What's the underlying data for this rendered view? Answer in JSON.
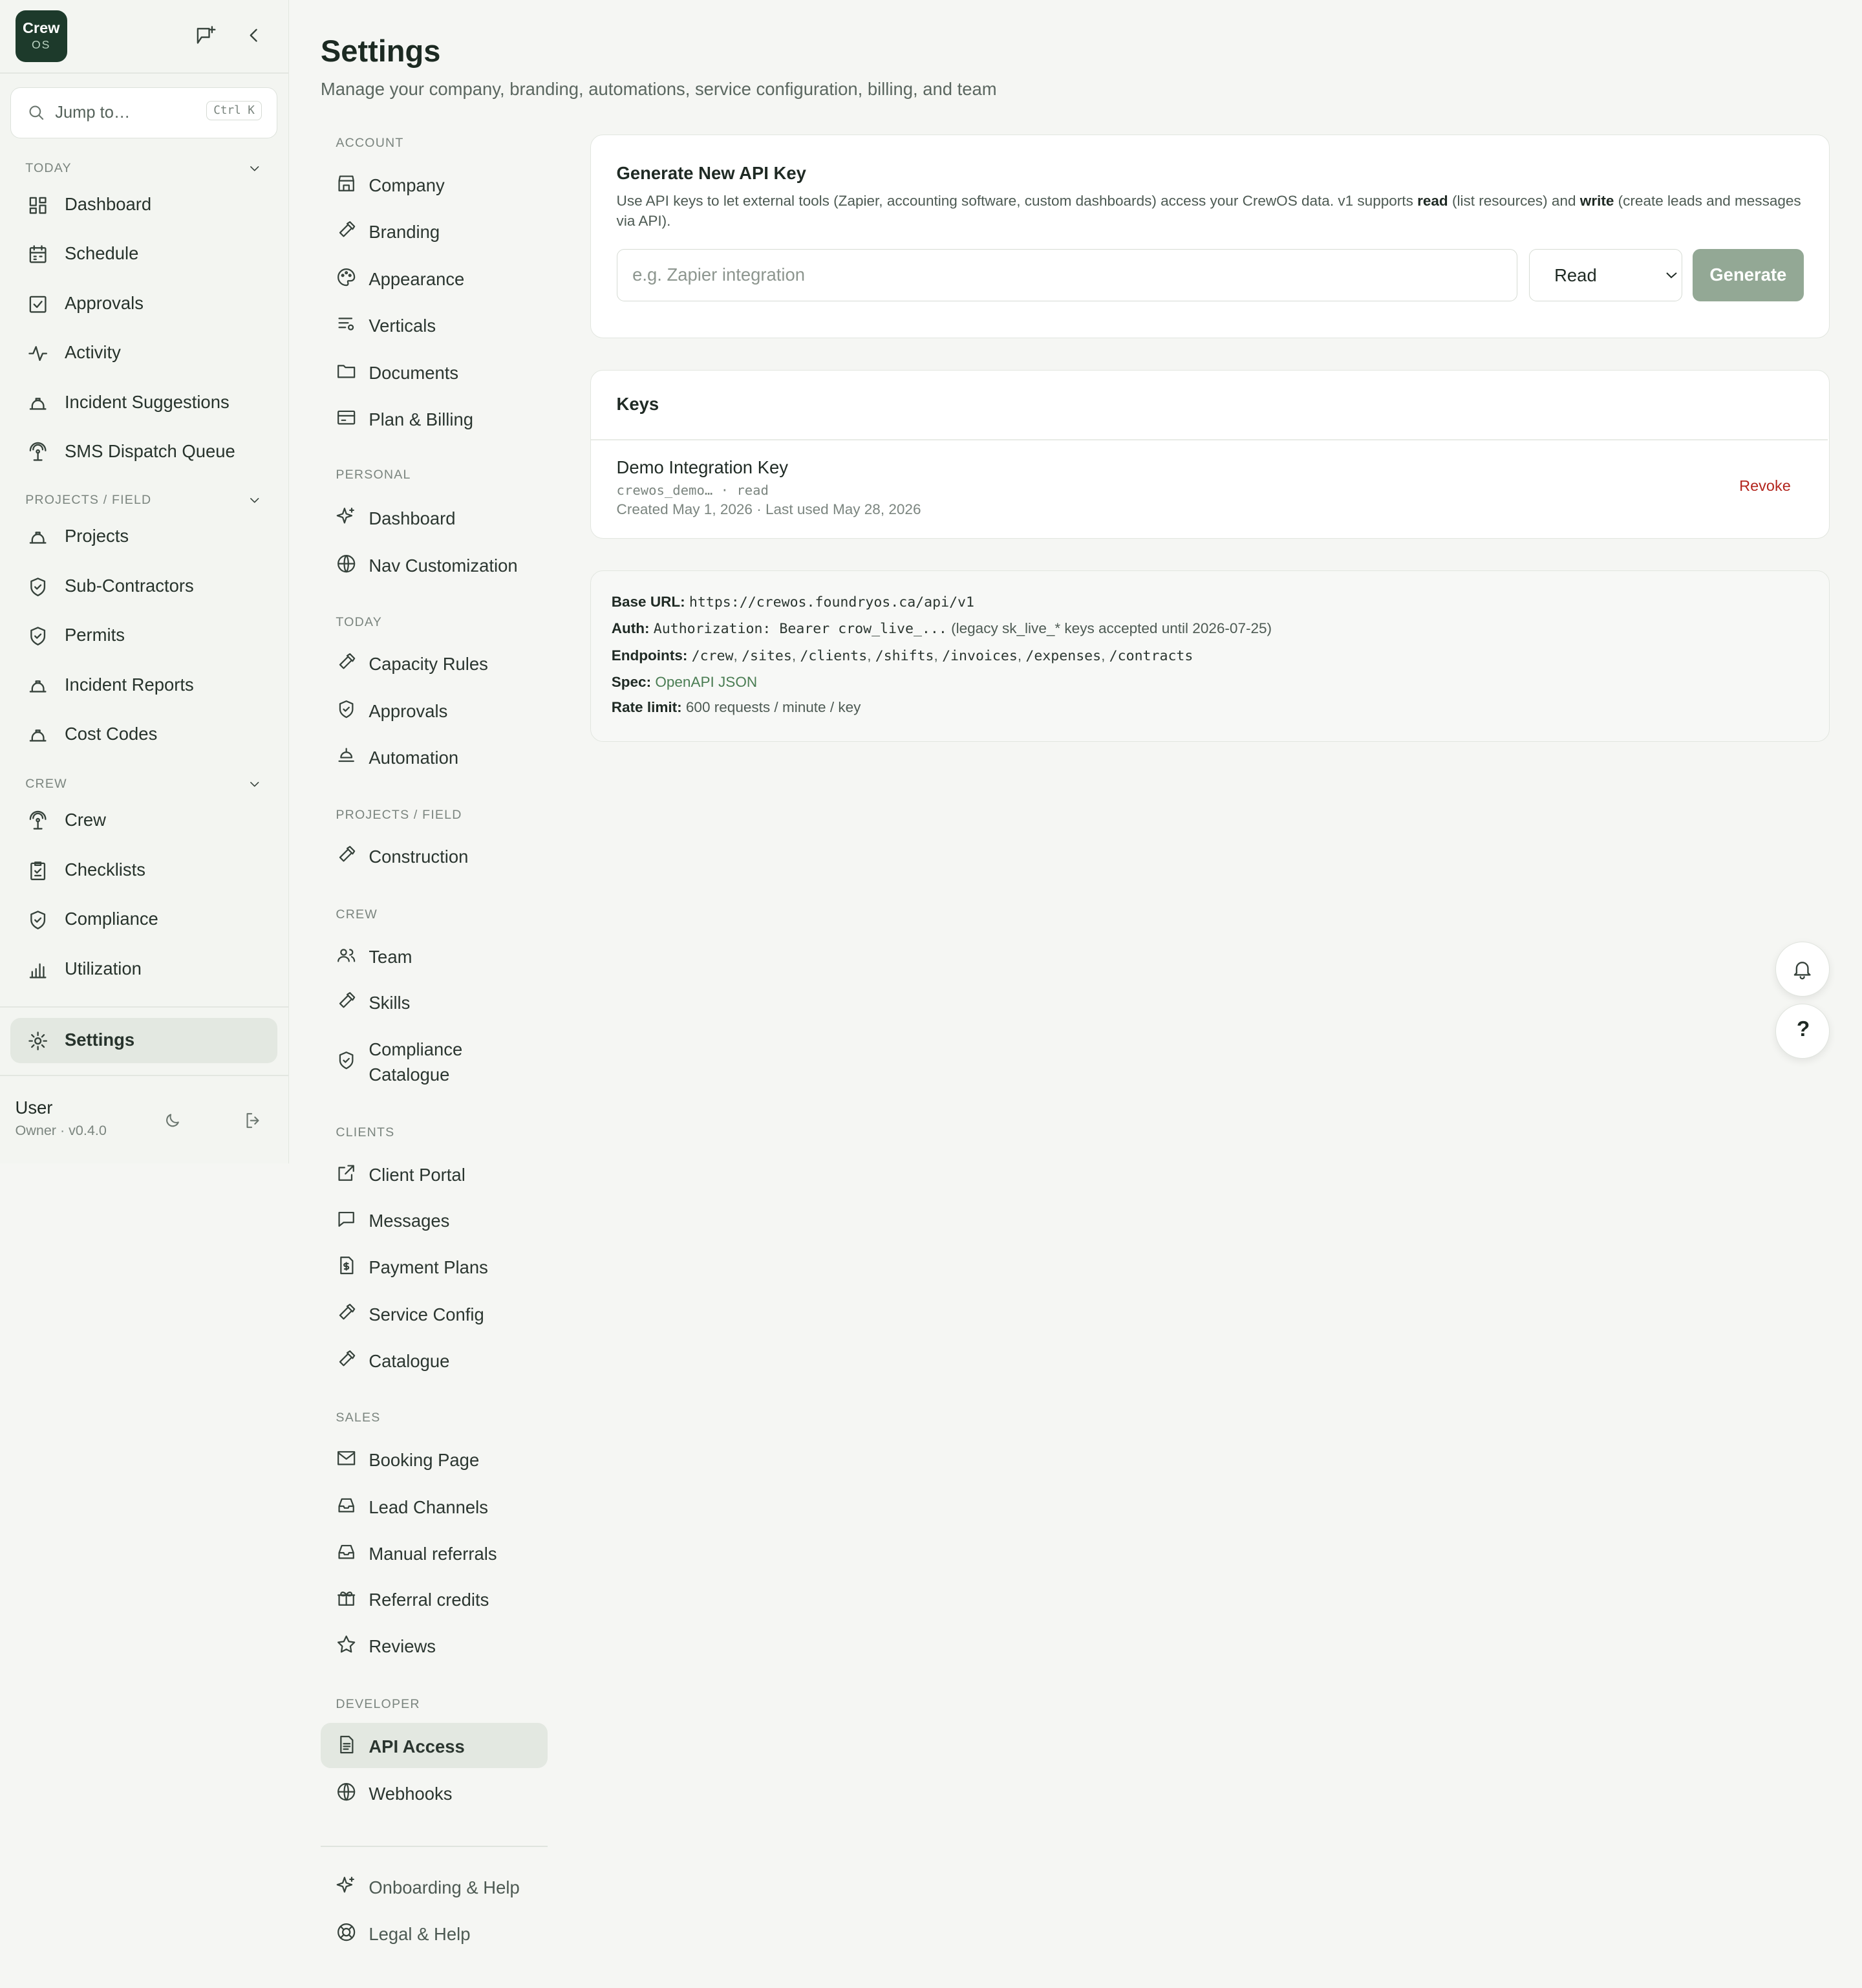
{
  "app": {
    "logo_top": "Crew",
    "logo_bottom": "OS"
  },
  "search": {
    "placeholder": "Jump to…",
    "shortcut": "Ctrl K"
  },
  "sidebar": {
    "sections": [
      {
        "title": "TODAY",
        "items": [
          "Dashboard",
          "Schedule",
          "Approvals",
          "Activity",
          "Incident Suggestions",
          "SMS Dispatch Queue"
        ]
      },
      {
        "title": "PROJECTS / FIELD",
        "items": [
          "Projects",
          "Sub-Contractors",
          "Permits",
          "Incident Reports",
          "Cost Codes"
        ]
      },
      {
        "title": "CREW",
        "items": [
          "Crew",
          "Checklists",
          "Compliance",
          "Utilization"
        ]
      }
    ],
    "settings_label": "Settings",
    "user": {
      "name": "User",
      "role": "Owner · v0.4.0"
    }
  },
  "page": {
    "title": "Settings",
    "subtitle": "Manage your company, branding, automations, service configuration, billing, and team"
  },
  "settings_nav": {
    "sections": [
      {
        "title": "ACCOUNT",
        "items": [
          "Company",
          "Branding",
          "Appearance",
          "Verticals",
          "Documents",
          "Plan & Billing"
        ]
      },
      {
        "title": "PERSONAL",
        "items": [
          "Dashboard",
          "Nav Customization"
        ]
      },
      {
        "title": "TODAY",
        "items": [
          "Capacity Rules",
          "Approvals",
          "Automation"
        ]
      },
      {
        "title": "PROJECTS / FIELD",
        "items": [
          "Construction"
        ]
      },
      {
        "title": "CREW",
        "items": [
          "Team",
          "Skills",
          "Compliance Catalogue"
        ]
      },
      {
        "title": "CLIENTS",
        "items": [
          "Client Portal",
          "Messages",
          "Payment Plans",
          "Service Config",
          "Catalogue"
        ]
      },
      {
        "title": "SALES",
        "items": [
          "Booking Page",
          "Lead Channels",
          "Manual referrals",
          "Referral credits",
          "Reviews"
        ]
      },
      {
        "title": "DEVELOPER",
        "items": [
          "API Access",
          "Webhooks"
        ]
      }
    ],
    "footer_items": [
      "Onboarding & Help",
      "Legal & Help"
    ],
    "active": "API Access"
  },
  "generate": {
    "title": "Generate New API Key",
    "desc_1": "Use API keys to let external tools (Zapier, accounting software, custom dashboards) access your CrewOS data. v1 supports ",
    "desc_read": "read",
    "desc_2": " (list resources) and ",
    "desc_write": "write",
    "desc_3": " (create leads and messages via API).",
    "name_placeholder": "e.g. Zapier integration",
    "scope_selected": "Read",
    "scope_options": [
      "Read"
    ],
    "button": "Generate"
  },
  "keys": {
    "title": "Keys",
    "items": [
      {
        "name": "Demo Integration Key",
        "meta": "crewos_demo… · read",
        "dates": "Created May 1, 2026 · Last used May 28, 2026",
        "action": "Revoke"
      }
    ]
  },
  "api_info": {
    "base_url_label": "Base URL:",
    "base_url": "https://crewos.foundryos.ca/api/v1",
    "auth_label": "Auth:",
    "auth_code": "Authorization: Bearer crow_live_...",
    "auth_note": "(legacy sk_live_* keys accepted until 2026-07-25)",
    "endpoints_label": "Endpoints:",
    "endpoints": [
      "/crew",
      "/sites",
      "/clients",
      "/shifts",
      "/invoices",
      "/expenses",
      "/contracts"
    ],
    "spec_label": "Spec:",
    "spec_link": "OpenAPI JSON",
    "rate_label": "Rate limit:",
    "rate": "600 requests / minute / key"
  },
  "floating": {
    "help": "?"
  },
  "colors": {
    "brand": "#1d3a2b",
    "accent": "#93a895",
    "danger": "#b3261e",
    "link": "#4a7d53"
  }
}
